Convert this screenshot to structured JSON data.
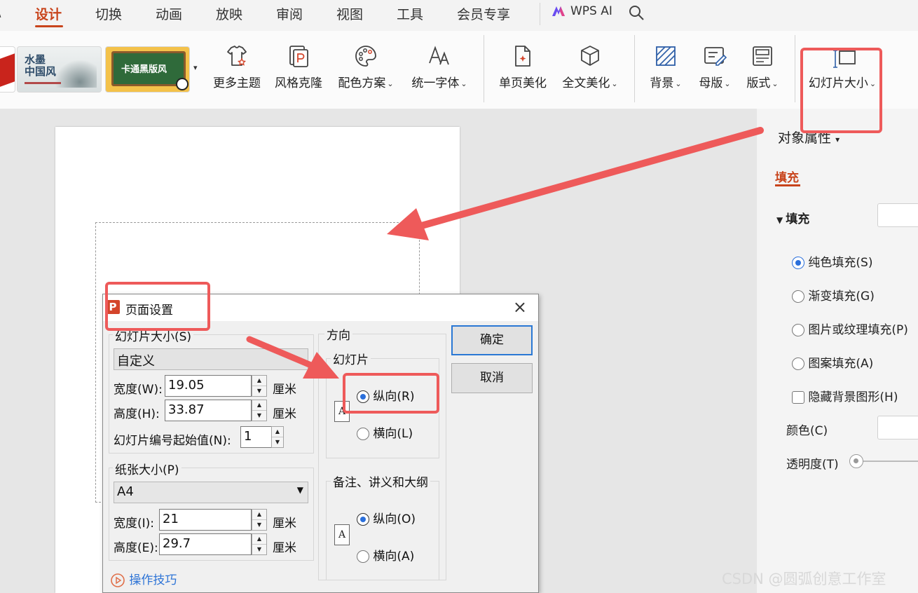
{
  "menubar": {
    "left_fragment": "\\",
    "tabs": [
      "设计",
      "切换",
      "动画",
      "放映",
      "审阅",
      "视图",
      "工具",
      "会员专享"
    ],
    "active_tab": "设计",
    "wps_ai": "WPS AI"
  },
  "ribbon": {
    "themes": [
      {
        "line1": "水墨",
        "line2": "中国风"
      },
      {
        "label": "卡通黑版风"
      }
    ],
    "tools": {
      "more_themes": "更多主题",
      "style_clone": "风格克隆",
      "color_scheme": "配色方案",
      "unify_font": "统一字体",
      "page_beautify": "单页美化",
      "full_beautify": "全文美化",
      "background": "背景",
      "master": "母版",
      "layout": "版式",
      "slide_size": "幻灯片大小"
    }
  },
  "right_panel": {
    "header": "对象属性",
    "tab": "填充",
    "section": "填充",
    "options": [
      {
        "label": "纯色填充(S)",
        "checked": true
      },
      {
        "label": "渐变填充(G)",
        "checked": false
      },
      {
        "label": "图片或纹理填充(P)",
        "checked": false
      },
      {
        "label": "图案填充(A)",
        "checked": false
      }
    ],
    "hide_bg": "隐藏背景图形(H)",
    "color_label": "颜色(C)",
    "transparency_label": "透明度(T)"
  },
  "dialog": {
    "title": "页面设置",
    "close": "×",
    "slide_size_group": "幻灯片大小(S)",
    "slide_size_value": "自定义",
    "width_label": "宽度(W):",
    "width_value": "19.05",
    "height_label": "高度(H):",
    "height_value": "33.87",
    "unit": "厘米",
    "start_num_label": "幻灯片编号起始值(N):",
    "start_num_value": "1",
    "paper_group": "纸张大小(P)",
    "paper_value": "A4",
    "paper_width_label": "宽度(I):",
    "paper_width_value": "21",
    "paper_height_label": "高度(E):",
    "paper_height_value": "29.7",
    "tips": "操作技巧",
    "orientation_group": "方向",
    "slides_subgroup": "幻灯片",
    "portrait_r": "纵向(R)",
    "landscape_l": "横向(L)",
    "notes_subgroup": "备注、讲义和大纲",
    "portrait_o": "纵向(O)",
    "landscape_a": "横向(A)",
    "ok": "确定",
    "cancel": "取消",
    "icon_letter": "A",
    "app_icon": "P"
  },
  "watermark": "CSDN @圆弧创意工作室",
  "colors": {
    "accent": "#c8441c",
    "annotation": "#ee5a5a",
    "primary_button": "#2a78d4",
    "radio": "#2a6fdb"
  }
}
